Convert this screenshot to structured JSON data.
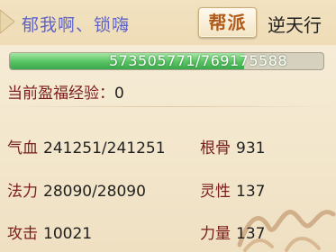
{
  "header": {
    "player_name": "郁我啊、锁嗨",
    "guild_button_label": "帮派",
    "guild_name": "逆天行"
  },
  "experience": {
    "text": "573505771/769175588",
    "current": 573505771,
    "max": 769175588,
    "fill_fraction": 0.746
  },
  "bonus_exp": {
    "label": "当前盈福经验：",
    "value": "0"
  },
  "stats": {
    "hp": {
      "label": "气血",
      "value": "241251/241251"
    },
    "constitution": {
      "label": "根骨",
      "value": "931"
    },
    "mana": {
      "label": "法力",
      "value": "28090/28090"
    },
    "spirit": {
      "label": "灵性",
      "value": "137"
    },
    "attack": {
      "label": "攻击",
      "value": "10021"
    },
    "strength": {
      "label": "力量",
      "value": "137"
    }
  },
  "colors": {
    "player_name": "#5d63c8",
    "stat_label": "#7a1c1c",
    "exp_fill": "#5cc666"
  },
  "icons": {
    "name_marker": "diamond-icon",
    "watermark": "game-logo"
  }
}
